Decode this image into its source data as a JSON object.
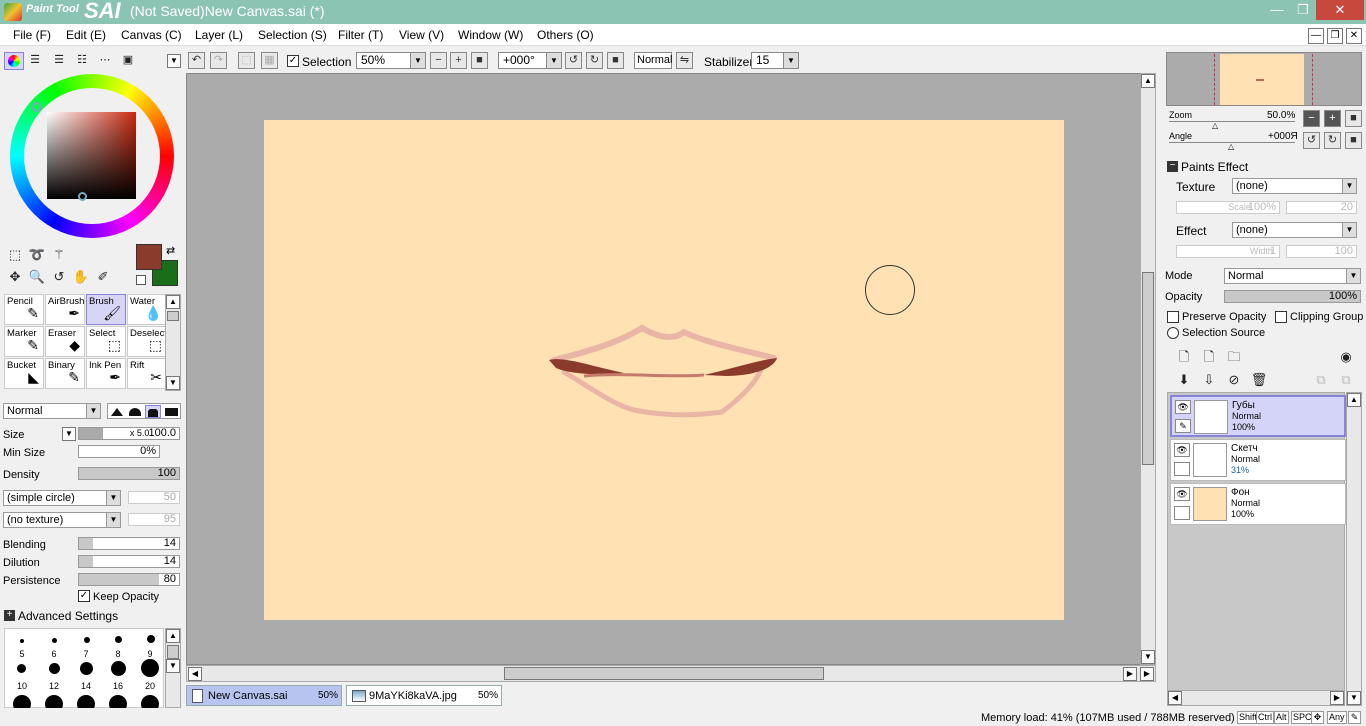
{
  "app": {
    "logo_small": "Paint Tool",
    "logo_big": "SAI",
    "title": "(Not Saved)New Canvas.sai (*)"
  },
  "menu": [
    "File (F)",
    "Edit (E)",
    "Canvas (C)",
    "Layer (L)",
    "Selection (S)",
    "Filter (T)",
    "View (V)",
    "Window (W)",
    "Others (O)"
  ],
  "toolbar": {
    "selection_label": "Selection",
    "zoom": "50%",
    "angle": "+000°",
    "blend": "Normal",
    "stabilizer_label": "Stabilizer",
    "stabilizer": "15"
  },
  "tools": [
    {
      "label": "Pencil",
      "icon": "pencil-icon",
      "glyph": "✎"
    },
    {
      "label": "AirBrush",
      "icon": "airbrush-icon",
      "glyph": "✒"
    },
    {
      "label": "Brush",
      "icon": "brush-icon",
      "glyph": "🖌"
    },
    {
      "label": "Water",
      "icon": "water-icon",
      "glyph": "💧"
    },
    {
      "label": "Marker",
      "icon": "marker-icon",
      "glyph": "✎"
    },
    {
      "label": "Eraser",
      "icon": "eraser-icon",
      "glyph": "◆"
    },
    {
      "label": "Select",
      "icon": "select-icon",
      "glyph": "⬚"
    },
    {
      "label": "Deselect",
      "icon": "deselect-icon",
      "glyph": "⬚"
    },
    {
      "label": "Bucket",
      "icon": "bucket-icon",
      "glyph": "◣"
    },
    {
      "label": "Binary",
      "icon": "binary-icon",
      "glyph": "✎"
    },
    {
      "label": "Ink Pen",
      "icon": "ink-pen-icon",
      "glyph": "✒"
    },
    {
      "label": "Rift",
      "icon": "rift-icon",
      "glyph": "✂"
    }
  ],
  "selected_tool": "Brush",
  "colors": {
    "primary": "#8a3b2c",
    "secondary": "#1a6e1a",
    "accent": "#8cc4b4"
  },
  "brush": {
    "mode": "Normal",
    "size_label": "Size",
    "size_mult": "x 5.0",
    "size": "100.0",
    "minsize_label": "Min Size",
    "minsize": "0%",
    "density_label": "Density",
    "density": "100",
    "shape": "(simple circle)",
    "shape_val": "50",
    "texture": "(no texture)",
    "texture_val": "95",
    "blending_label": "Blending",
    "blending": "14",
    "dilution_label": "Dilution",
    "dilution": "14",
    "persistence_label": "Persistence",
    "persistence": "80",
    "keep_opacity": "Keep Opacity",
    "advanced": "Advanced Settings",
    "presets1": [
      "5",
      "6",
      "7",
      "8",
      "9"
    ],
    "presets2": [
      "10",
      "12",
      "14",
      "16",
      "20"
    ]
  },
  "navigator": {
    "zoom_label": "Zoom",
    "zoom": "50.0%",
    "angle_label": "Angle",
    "angle": "+000Я"
  },
  "paints_effect": {
    "title": "Paints Effect",
    "texture_label": "Texture",
    "texture": "(none)",
    "scale_label": "Scale",
    "scale": "100%",
    "scale_val": "20",
    "effect_label": "Effect",
    "effect": "(none)",
    "width_label": "Width",
    "width": "1",
    "width_val": "100"
  },
  "layer_props": {
    "mode_label": "Mode",
    "mode": "Normal",
    "opacity_label": "Opacity",
    "opacity": "100%",
    "preserve": "Preserve Opacity",
    "clipping": "Clipping Group",
    "source": "Selection Source"
  },
  "layers": [
    {
      "name": "Губы",
      "mode": "Normal",
      "opacity": "100%",
      "selected": true
    },
    {
      "name": "Скетч",
      "mode": "Normal",
      "opacity": "31%",
      "selected": false
    },
    {
      "name": "Фон",
      "mode": "Normal",
      "opacity": "100%",
      "selected": false
    }
  ],
  "doc_tabs": [
    {
      "name": "New Canvas.sai",
      "zoom": "50%"
    },
    {
      "name": "9MaYKi8kaVA.jpg",
      "zoom": "50%"
    }
  ],
  "status": {
    "memory": "Memory load: 41% (107MB used / 788MB reserved)",
    "keys": [
      "Shift",
      "Ctrl",
      "Alt",
      "SPC",
      "Any"
    ]
  }
}
